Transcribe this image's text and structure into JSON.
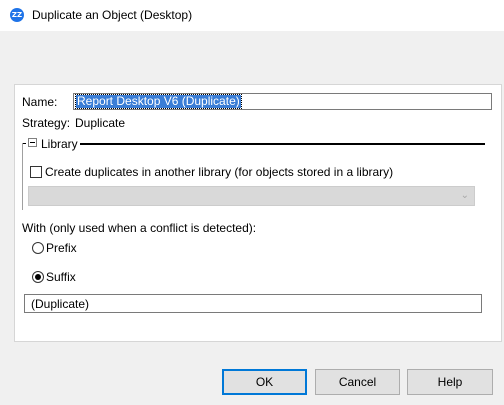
{
  "window": {
    "title": "Duplicate an Object (Desktop)",
    "icon": "zz-app-icon",
    "icon_text": "ZZ"
  },
  "form": {
    "name_label": "Name:",
    "name_value": "Report Desktop V6 (Duplicate)",
    "strategy_label": "Strategy:",
    "strategy_value": "Duplicate"
  },
  "library": {
    "group_label": "Library",
    "checkbox_label": "Create duplicates in another library (for objects stored in a library)",
    "checkbox_checked": false,
    "select_value": ""
  },
  "conflict": {
    "label": "With (only used when a conflict is detected):",
    "options": [
      {
        "label": "Prefix",
        "selected": false
      },
      {
        "label": "Suffix",
        "selected": true
      }
    ],
    "value": "(Duplicate)"
  },
  "buttons": {
    "ok": "OK",
    "cancel": "Cancel",
    "help": "Help"
  }
}
